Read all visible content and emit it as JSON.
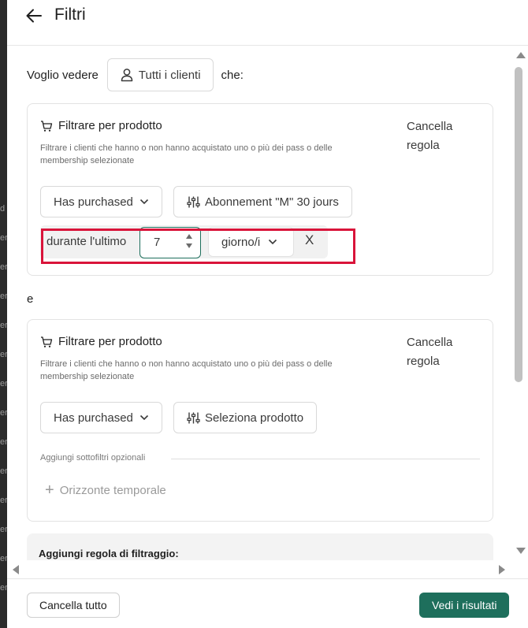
{
  "header": {
    "title": "Filtri",
    "back_icon": "arrow-left-icon"
  },
  "left_strip": {
    "fragments": [
      "d",
      "er",
      "er",
      "er",
      "er",
      "er",
      "er",
      "er",
      "er",
      "er",
      "er",
      "er",
      "er",
      "er"
    ]
  },
  "intro": {
    "prefix": "Voglio vedere",
    "clients_button": "Tutti i clienti",
    "suffix": "che:"
  },
  "rule1": {
    "title": "Filtrare per prodotto",
    "description": "Filtrare i clienti che hanno o non hanno acquistato uno o più dei pass o delle membership selezionate",
    "cancel_label": "Cancella regola",
    "condition": "Has purchased",
    "product": "Abonnement \"M\" 30 jours",
    "during_label": "durante l'ultimo",
    "number_value": "7",
    "unit": "giorno/i",
    "remove_label": "X"
  },
  "connector": "e",
  "rule2": {
    "title": "Filtrare per prodotto",
    "description": "Filtrare i clienti che hanno o non hanno acquistato uno o più dei pass o delle membership selezionate",
    "cancel_label": "Cancella regola",
    "condition": "Has purchased",
    "product": "Seleziona prodotto",
    "optional_label": "Aggiungi sottofiltri opzionali",
    "time_horizon": "Orizzonte temporale"
  },
  "add_rule": {
    "label": "Aggiungi regola di filtraggio:"
  },
  "footer": {
    "cancel_all": "Cancella tutto",
    "see_results": "Vedi i risultati"
  },
  "colors": {
    "primary": "#1e6f5c",
    "highlight": "#d9143a"
  }
}
